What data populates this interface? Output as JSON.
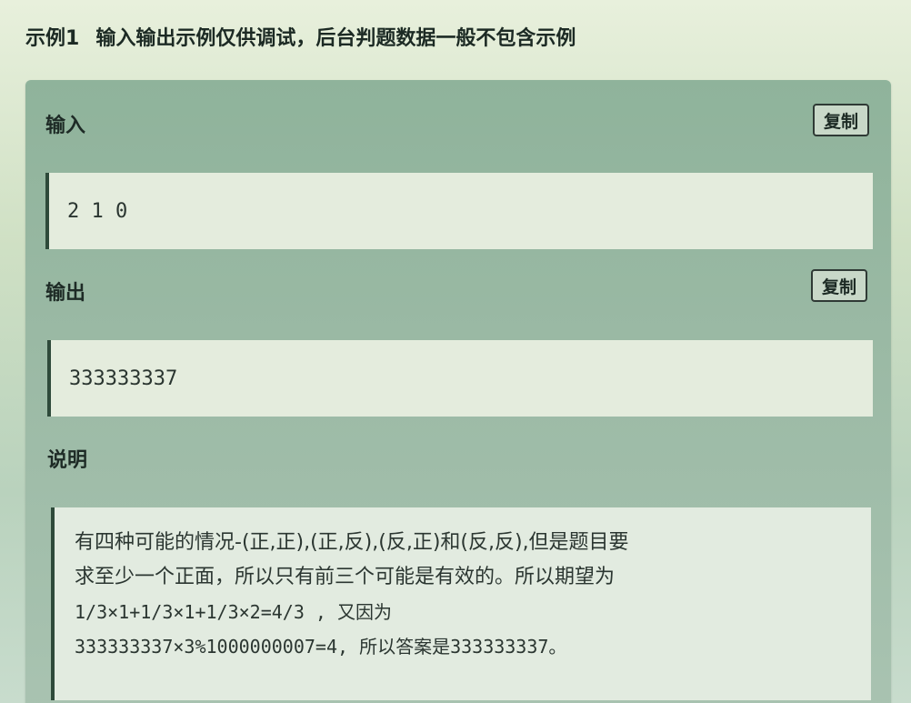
{
  "header": {
    "example_label": "示例1",
    "note": "输入输出示例仅供调试，后台判题数据一般不包含示例"
  },
  "input_section": {
    "title": "输入",
    "copy_label": "复制",
    "value": "2 1 0"
  },
  "output_section": {
    "title": "输出",
    "copy_label": "复制",
    "value": "333333337"
  },
  "explanation_section": {
    "title": "说明",
    "lines": [
      "有四种可能的情况-(正,正),(正,反),(反,正)和(反,反),但是题目要",
      "求至少一个正面，所以只有前三个可能是有效的。所以期望为",
      "1/3×1+1/3×1+1/3×2=4/3 , 又因为",
      "333333337×3%1000000007=4, 所以答案是333333337。"
    ]
  }
}
